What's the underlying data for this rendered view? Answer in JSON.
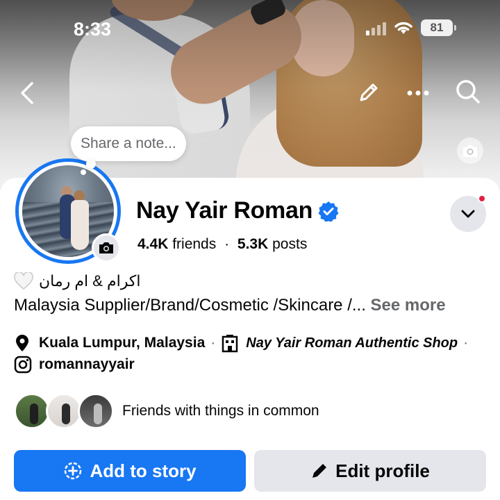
{
  "status_bar": {
    "time": "8:33",
    "battery": "81"
  },
  "cover": {
    "back_icon": "chevron-left-icon",
    "edit_icon": "pencil-icon",
    "more_icon": "more-dots-icon",
    "search_icon": "search-icon",
    "camera_icon": "camera-icon"
  },
  "note": {
    "placeholder": "Share a note..."
  },
  "profile": {
    "name": "Nay Yair Roman",
    "verified": true,
    "friends_count": "4.4K",
    "friends_label": "friends",
    "posts_count": "5.3K",
    "posts_label": "posts"
  },
  "bio": {
    "line1": "اكرام & ام رمان",
    "line2": "Malaysia Supplier/Brand/Cosmetic /Skincare /...",
    "see_more": "See more"
  },
  "details": {
    "location": "Kuala Lumpur, Malaysia",
    "shop": "Nay Yair Roman Authentic Shop",
    "instagram": "romannayyair"
  },
  "friends_common": {
    "text": "Friends with things in common"
  },
  "actions": {
    "add_story": "Add to story",
    "edit_profile": "Edit profile"
  },
  "colors": {
    "accent": "#1877f2",
    "secondary_button": "#e4e6eb",
    "notification": "#e41e3f"
  }
}
